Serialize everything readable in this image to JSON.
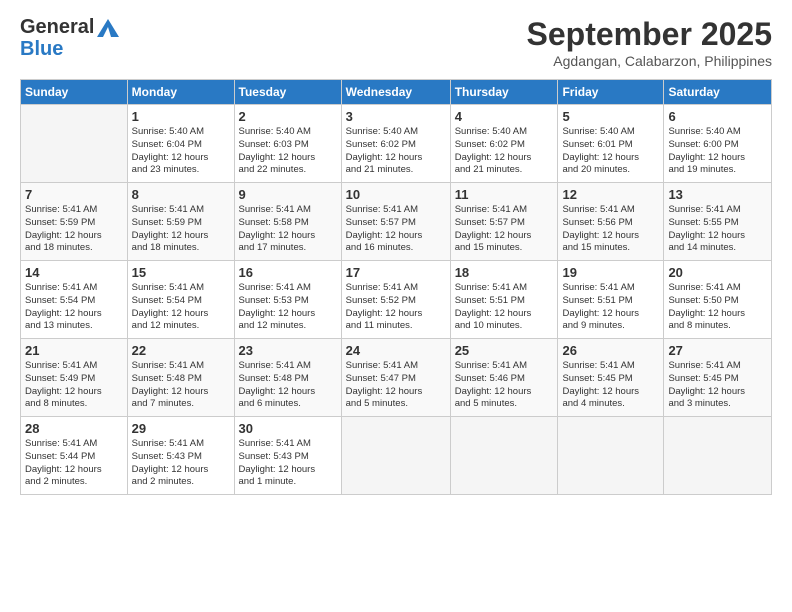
{
  "header": {
    "logo_line1": "General",
    "logo_line2": "Blue",
    "month": "September 2025",
    "location": "Agdangan, Calabarzon, Philippines"
  },
  "days_of_week": [
    "Sunday",
    "Monday",
    "Tuesday",
    "Wednesday",
    "Thursday",
    "Friday",
    "Saturday"
  ],
  "weeks": [
    [
      {
        "day": "",
        "info": ""
      },
      {
        "day": "1",
        "info": "Sunrise: 5:40 AM\nSunset: 6:04 PM\nDaylight: 12 hours\nand 23 minutes."
      },
      {
        "day": "2",
        "info": "Sunrise: 5:40 AM\nSunset: 6:03 PM\nDaylight: 12 hours\nand 22 minutes."
      },
      {
        "day": "3",
        "info": "Sunrise: 5:40 AM\nSunset: 6:02 PM\nDaylight: 12 hours\nand 21 minutes."
      },
      {
        "day": "4",
        "info": "Sunrise: 5:40 AM\nSunset: 6:02 PM\nDaylight: 12 hours\nand 21 minutes."
      },
      {
        "day": "5",
        "info": "Sunrise: 5:40 AM\nSunset: 6:01 PM\nDaylight: 12 hours\nand 20 minutes."
      },
      {
        "day": "6",
        "info": "Sunrise: 5:40 AM\nSunset: 6:00 PM\nDaylight: 12 hours\nand 19 minutes."
      }
    ],
    [
      {
        "day": "7",
        "info": "Sunrise: 5:41 AM\nSunset: 5:59 PM\nDaylight: 12 hours\nand 18 minutes."
      },
      {
        "day": "8",
        "info": "Sunrise: 5:41 AM\nSunset: 5:59 PM\nDaylight: 12 hours\nand 18 minutes."
      },
      {
        "day": "9",
        "info": "Sunrise: 5:41 AM\nSunset: 5:58 PM\nDaylight: 12 hours\nand 17 minutes."
      },
      {
        "day": "10",
        "info": "Sunrise: 5:41 AM\nSunset: 5:57 PM\nDaylight: 12 hours\nand 16 minutes."
      },
      {
        "day": "11",
        "info": "Sunrise: 5:41 AM\nSunset: 5:57 PM\nDaylight: 12 hours\nand 15 minutes."
      },
      {
        "day": "12",
        "info": "Sunrise: 5:41 AM\nSunset: 5:56 PM\nDaylight: 12 hours\nand 15 minutes."
      },
      {
        "day": "13",
        "info": "Sunrise: 5:41 AM\nSunset: 5:55 PM\nDaylight: 12 hours\nand 14 minutes."
      }
    ],
    [
      {
        "day": "14",
        "info": "Sunrise: 5:41 AM\nSunset: 5:54 PM\nDaylight: 12 hours\nand 13 minutes."
      },
      {
        "day": "15",
        "info": "Sunrise: 5:41 AM\nSunset: 5:54 PM\nDaylight: 12 hours\nand 12 minutes."
      },
      {
        "day": "16",
        "info": "Sunrise: 5:41 AM\nSunset: 5:53 PM\nDaylight: 12 hours\nand 12 minutes."
      },
      {
        "day": "17",
        "info": "Sunrise: 5:41 AM\nSunset: 5:52 PM\nDaylight: 12 hours\nand 11 minutes."
      },
      {
        "day": "18",
        "info": "Sunrise: 5:41 AM\nSunset: 5:51 PM\nDaylight: 12 hours\nand 10 minutes."
      },
      {
        "day": "19",
        "info": "Sunrise: 5:41 AM\nSunset: 5:51 PM\nDaylight: 12 hours\nand 9 minutes."
      },
      {
        "day": "20",
        "info": "Sunrise: 5:41 AM\nSunset: 5:50 PM\nDaylight: 12 hours\nand 8 minutes."
      }
    ],
    [
      {
        "day": "21",
        "info": "Sunrise: 5:41 AM\nSunset: 5:49 PM\nDaylight: 12 hours\nand 8 minutes."
      },
      {
        "day": "22",
        "info": "Sunrise: 5:41 AM\nSunset: 5:48 PM\nDaylight: 12 hours\nand 7 minutes."
      },
      {
        "day": "23",
        "info": "Sunrise: 5:41 AM\nSunset: 5:48 PM\nDaylight: 12 hours\nand 6 minutes."
      },
      {
        "day": "24",
        "info": "Sunrise: 5:41 AM\nSunset: 5:47 PM\nDaylight: 12 hours\nand 5 minutes."
      },
      {
        "day": "25",
        "info": "Sunrise: 5:41 AM\nSunset: 5:46 PM\nDaylight: 12 hours\nand 5 minutes."
      },
      {
        "day": "26",
        "info": "Sunrise: 5:41 AM\nSunset: 5:45 PM\nDaylight: 12 hours\nand 4 minutes."
      },
      {
        "day": "27",
        "info": "Sunrise: 5:41 AM\nSunset: 5:45 PM\nDaylight: 12 hours\nand 3 minutes."
      }
    ],
    [
      {
        "day": "28",
        "info": "Sunrise: 5:41 AM\nSunset: 5:44 PM\nDaylight: 12 hours\nand 2 minutes."
      },
      {
        "day": "29",
        "info": "Sunrise: 5:41 AM\nSunset: 5:43 PM\nDaylight: 12 hours\nand 2 minutes."
      },
      {
        "day": "30",
        "info": "Sunrise: 5:41 AM\nSunset: 5:43 PM\nDaylight: 12 hours\nand 1 minute."
      },
      {
        "day": "",
        "info": ""
      },
      {
        "day": "",
        "info": ""
      },
      {
        "day": "",
        "info": ""
      },
      {
        "day": "",
        "info": ""
      }
    ]
  ]
}
